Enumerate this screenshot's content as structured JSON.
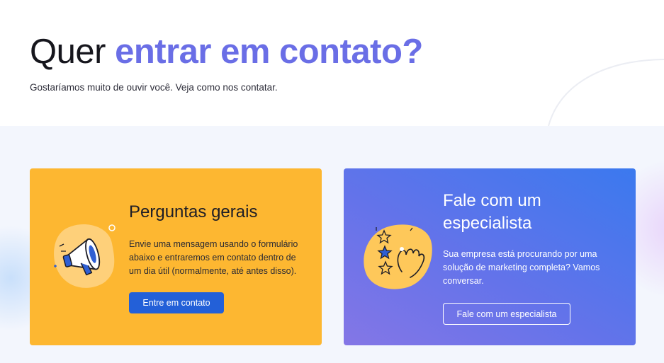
{
  "header": {
    "title_plain": "Quer",
    "title_accent": "entrar em contato?",
    "subtitle": "Gostaríamos muito de ouvir você. Veja como nos contatar."
  },
  "cards": [
    {
      "title": "Perguntas gerais",
      "text": "Envie uma mensagem usando o formulário abaixo e entraremos em contato dentro de um dia útil (normalmente, até antes disso).",
      "button_label": "Entre em contato",
      "icon": "megaphone-icon"
    },
    {
      "title": "Fale com um especialista",
      "text": "Sua empresa está procurando por uma solução de marketing completa? Vamos conversar.",
      "button_label": "Fale com um especialista",
      "icon": "stars-hand-icon"
    }
  ],
  "colors": {
    "accent": "#6a6ee6",
    "card_yellow": "#fdb731",
    "card_blue_start": "#3b79ee",
    "card_blue_end": "#8476e6",
    "button_primary": "#2360d8",
    "section_background": "#f3f6fd"
  }
}
